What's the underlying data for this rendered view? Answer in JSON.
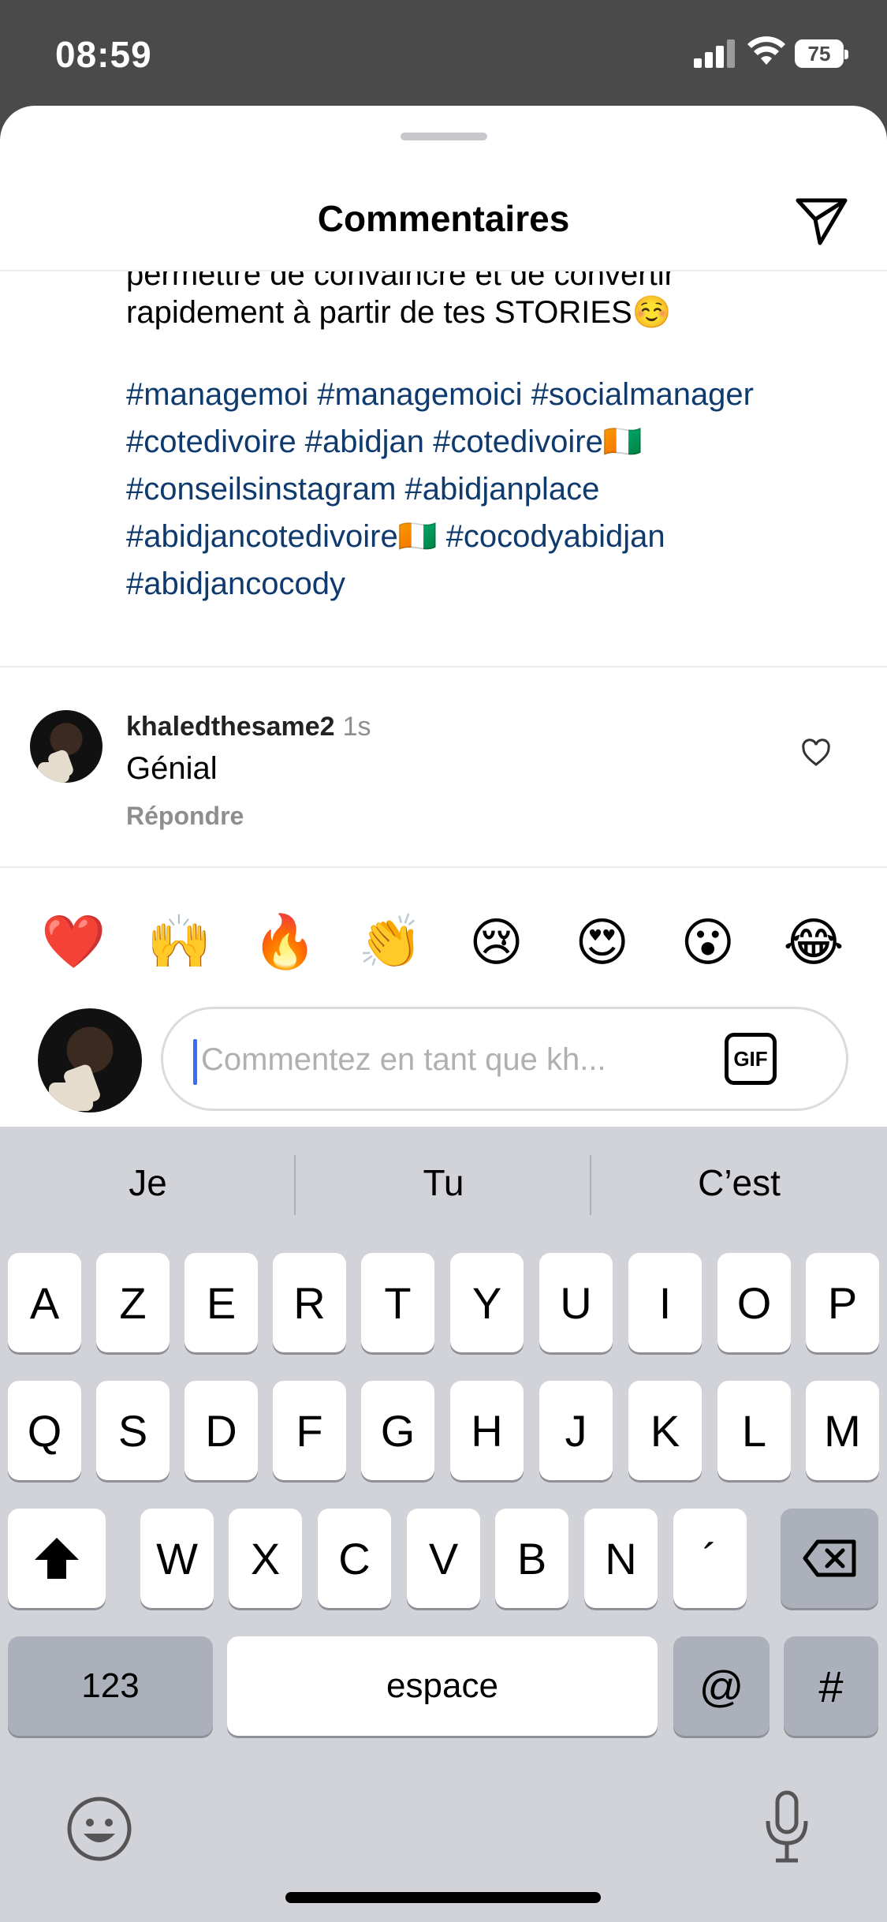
{
  "status_bar": {
    "time": "08:59",
    "battery": "75"
  },
  "sheet": {
    "title": "Commentaires"
  },
  "caption": {
    "line1": "permettre de convaincre et de convertir",
    "line2": "rapidement à partir de tes STORIES☺️",
    "hashtags": [
      "#managemoi #managemoici #socialmanager",
      "#cotedivoire #abidjan #cotedivoire🇨🇮",
      "#conseilsinstagram #abidjanplace",
      "#abidjancotedivoire🇨🇮 #cocodyabidjan",
      "#abidjancocody"
    ]
  },
  "comment": {
    "username": "khaledthesame2",
    "time": "1s",
    "text": "Génial",
    "reply_label": "Répondre"
  },
  "reactions": [
    "❤️",
    "🙌",
    "🔥",
    "👏",
    "😢",
    "😍",
    "😮",
    "😂"
  ],
  "composer": {
    "placeholder": "Commentez en tant que kh...",
    "gif_label": "GIF"
  },
  "keyboard": {
    "suggestions": [
      "Je",
      "Tu",
      "C’est"
    ],
    "row1": [
      "A",
      "Z",
      "E",
      "R",
      "T",
      "Y",
      "U",
      "I",
      "O",
      "P"
    ],
    "row2": [
      "Q",
      "S",
      "D",
      "F",
      "G",
      "H",
      "J",
      "K",
      "L",
      "M"
    ],
    "row3": [
      "W",
      "X",
      "C",
      "V",
      "B",
      "N",
      "´"
    ],
    "numbers_label": "123",
    "space_label": "espace",
    "at_label": "@",
    "hash_label": "#"
  }
}
